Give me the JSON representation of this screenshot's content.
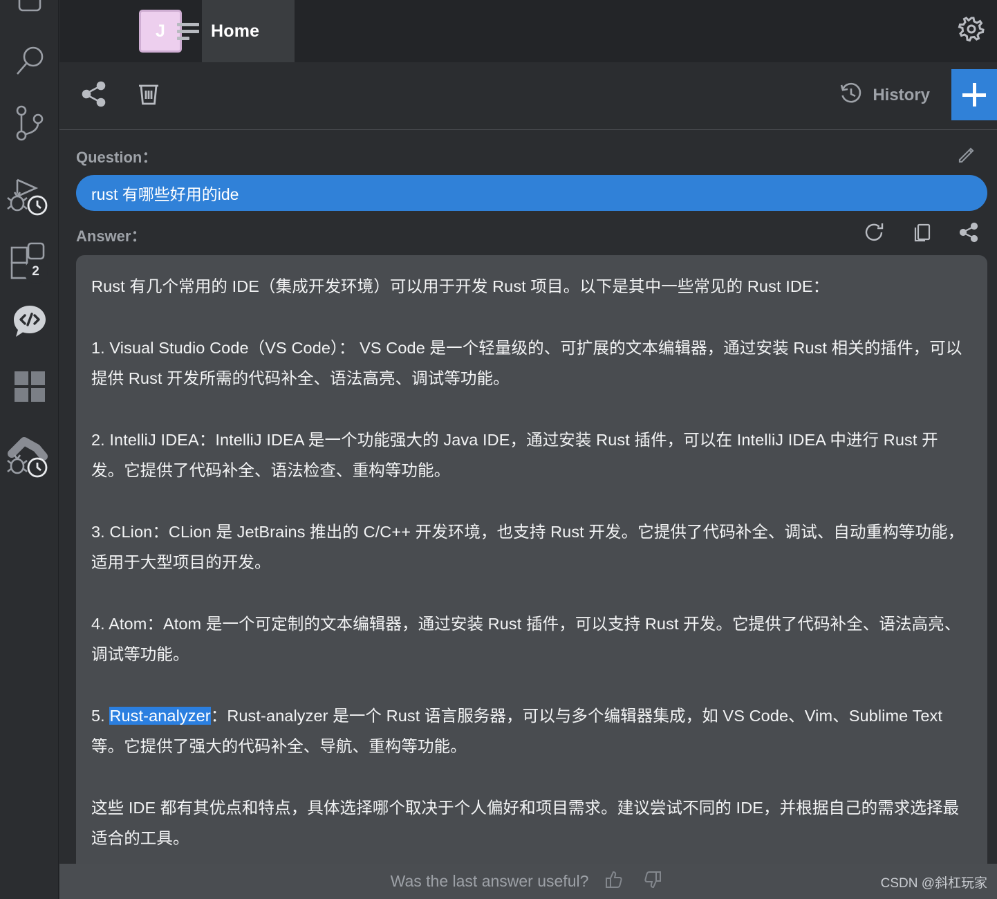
{
  "window": {
    "tab_label": "Home",
    "avatar_initial": "J",
    "gear_icon": "gear-icon",
    "hamburger_icon": "menu-icon"
  },
  "sidebar": {
    "items": [
      {
        "icon": "rounded-rect-icon",
        "label": ""
      },
      {
        "icon": "search-icon",
        "label": ""
      },
      {
        "icon": "branch-icon",
        "label": ""
      },
      {
        "icon": "run-debug-history-icon",
        "label": ""
      },
      {
        "icon": "plugins-icon",
        "label": "",
        "badge": "2"
      },
      {
        "icon": "code-chat-icon",
        "label": ""
      },
      {
        "icon": "grid-icon",
        "label": ""
      },
      {
        "icon": "build-debug-history-icon",
        "label": ""
      }
    ]
  },
  "toolbar": {
    "share_icon": "share-icon",
    "delete_icon": "trash-icon",
    "history_label": "History",
    "history_icon": "history-clock-icon",
    "new_chat_icon": "plus-icon"
  },
  "question": {
    "label": "Question：",
    "text": "rust 有哪些好用的ide",
    "edit_icon": "pencil-icon"
  },
  "answer": {
    "label": "Answer：",
    "actions": [
      {
        "icon": "refresh-icon",
        "name": "regenerate"
      },
      {
        "icon": "copy-icon",
        "name": "copy"
      },
      {
        "icon": "share-icon",
        "name": "share"
      }
    ],
    "highlight_text": "Rust-analyzer",
    "paragraphs": [
      "Rust 有几个常用的 IDE（集成开发环境）可以用于开发 Rust 项目。以下是其中一些常见的 Rust IDE：",
      "1. Visual Studio Code（VS Code）： VS Code 是一个轻量级的、可扩展的文本编辑器，通过安装 Rust 相关的插件，可以提供 Rust 开发所需的代码补全、语法高亮、调试等功能。",
      "2. IntelliJ IDEA：IntelliJ IDEA 是一个功能强大的 Java IDE，通过安装 Rust 插件，可以在 IntelliJ IDEA 中进行 Rust 开发。它提供了代码补全、语法检查、重构等功能。",
      "3. CLion：CLion 是 JetBrains 推出的 C/C++ 开发环境，也支持 Rust 开发。它提供了代码补全、调试、自动重构等功能，适用于大型项目的开发。",
      "4. Atom：Atom 是一个可定制的文本编辑器，通过安装 Rust 插件，可以支持 Rust 开发。它提供了代码补全、语法高亮、调试等功能。",
      "5. ",
      "：Rust-analyzer 是一个 Rust 语言服务器，可以与多个编辑器集成，如 VS Code、Vim、Sublime Text 等。它提供了强大的代码补全、导航、重构等功能。",
      "这些 IDE 都有其优点和特点，具体选择哪个取决于个人偏好和项目需求。建议尝试不同的 IDE，并根据自己的需求选择最适合的工具。"
    ]
  },
  "footer": {
    "prompt": "Was the last answer useful?",
    "thumbs_up_icon": "thumbs-up-icon",
    "thumbs_down_icon": "thumbs-down-icon"
  },
  "watermark": "CSDN @斜杠玩家",
  "colors": {
    "accent_blue": "#3081d8",
    "panel_bg": "#2b2d30",
    "answer_bg": "#494c50",
    "avatar_pink": "#edcfee"
  }
}
